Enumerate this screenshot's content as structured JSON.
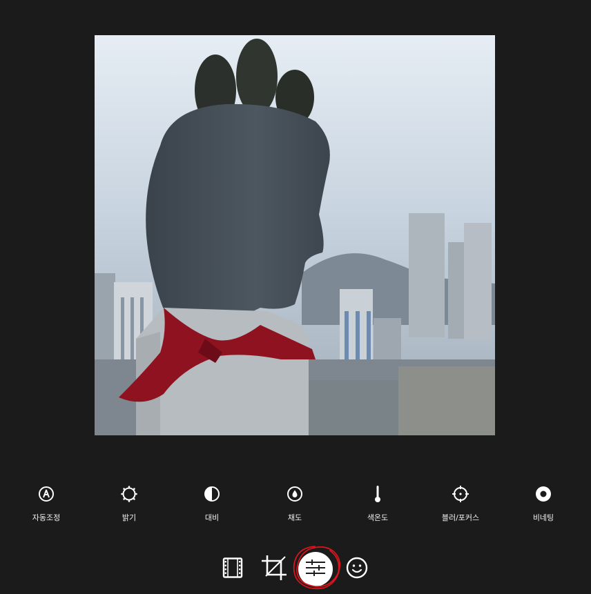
{
  "photo": {
    "alt_icon": "photo-preview"
  },
  "adjustments": [
    {
      "id": "auto",
      "label": "자동조정",
      "icon": "auto-adjust-icon"
    },
    {
      "id": "brightness",
      "label": "밝기",
      "icon": "sun-icon"
    },
    {
      "id": "contrast",
      "label": "대비",
      "icon": "contrast-icon"
    },
    {
      "id": "saturation",
      "label": "채도",
      "icon": "drop-icon"
    },
    {
      "id": "temperature",
      "label": "색온도",
      "icon": "thermometer-icon"
    },
    {
      "id": "blur",
      "label": "블러/포커스",
      "icon": "crosshair-icon"
    },
    {
      "id": "vignette",
      "label": "비네팅",
      "icon": "vignette-icon"
    }
  ],
  "bottom_nav": [
    {
      "id": "filter",
      "icon": "film-icon"
    },
    {
      "id": "crop",
      "icon": "crop-icon"
    },
    {
      "id": "adjust",
      "icon": "sliders-icon",
      "active": true
    },
    {
      "id": "sticker",
      "icon": "smiley-icon"
    }
  ],
  "colors": {
    "background": "#1b1b1b",
    "icon": "#ffffff",
    "annotation": "#d9141c"
  }
}
